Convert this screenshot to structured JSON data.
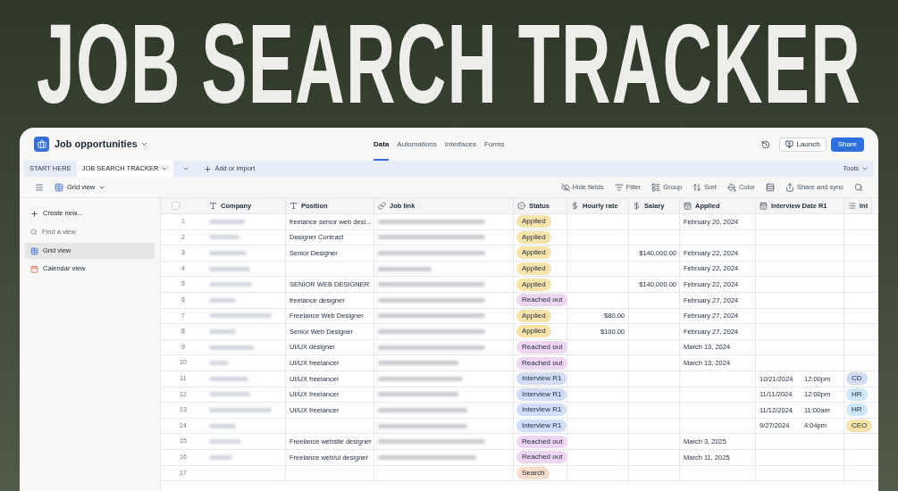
{
  "title": "JOB SEARCH TRACKER",
  "app": {
    "base_name": "Job opportunities",
    "nav_tabs": [
      {
        "label": "Data",
        "selected": true
      },
      {
        "label": "Automations",
        "selected": false
      },
      {
        "label": "Interfaces",
        "selected": false
      },
      {
        "label": "Forms",
        "selected": false
      }
    ],
    "launch": "Launch",
    "share": "Share"
  },
  "table_tabs": [
    {
      "label": "START HERE",
      "selected": false,
      "dropdown": false
    },
    {
      "label": "JOB SEARCH TRACKER",
      "selected": true,
      "dropdown": true
    }
  ],
  "select_all": {
    "checked": false
  },
  "add_import": "Add or import",
  "tools": "Tools",
  "view_name": "Grid view",
  "toolbar": [
    {
      "kind": "hide",
      "label": "Hide fields"
    },
    {
      "kind": "filter",
      "label": "Filter"
    },
    {
      "kind": "group",
      "label": "Group"
    },
    {
      "kind": "sort",
      "label": "Sort"
    },
    {
      "kind": "color",
      "label": "Color"
    },
    {
      "kind": "height"
    },
    {
      "kind": "share",
      "label": "Share and sync"
    },
    {
      "kind": "search"
    }
  ],
  "sidebar": {
    "create": "Create new...",
    "find_placeholder": "Find a view",
    "views": [
      {
        "kind": "grid",
        "label": "Grid view",
        "selected": true
      },
      {
        "kind": "calendar",
        "label": "Calendar view",
        "selected": false
      }
    ]
  },
  "columns": [
    {
      "kind": "text",
      "label": "Company"
    },
    {
      "kind": "text",
      "label": "Position"
    },
    {
      "kind": "link",
      "label": "Job link"
    },
    {
      "kind": "select",
      "label": "Status"
    },
    {
      "kind": "currency",
      "label": "Hourly rate"
    },
    {
      "kind": "currency",
      "label": "Salary"
    },
    {
      "kind": "date",
      "label": "Applied"
    },
    {
      "kind": "date",
      "label": "Interview Date R1"
    },
    {
      "kind": "multi",
      "label": "Int"
    }
  ],
  "rows": [
    {
      "n": "1",
      "company_blurred": true,
      "position": "freelance senior web desi...",
      "link_blurred": true,
      "status": {
        "label": "Applied",
        "color": "#f6e3a9"
      },
      "applied": "February 20, 2024"
    },
    {
      "n": "2",
      "company_blurred": true,
      "position": "Designer Contract",
      "link_blurred": true,
      "status": {
        "label": "Applied",
        "color": "#f6e3a9"
      }
    },
    {
      "n": "3",
      "company_blurred": true,
      "position": "Senior Designer",
      "link_blurred": true,
      "status": {
        "label": "Applied",
        "color": "#f6e3a9"
      },
      "salary": "$140,000.00",
      "applied": "February 22, 2024"
    },
    {
      "n": "4",
      "company_blurred": true,
      "link_blurred": true,
      "status": {
        "label": "Applied",
        "color": "#f6e3a9"
      },
      "applied": "February 22, 2024"
    },
    {
      "n": "5",
      "company_blurred": true,
      "position": "SENIOR WEB DESIGNER",
      "link_blurred": true,
      "status": {
        "label": "Applied",
        "color": "#f6e3a9"
      },
      "salary": "$140,000.00",
      "applied": "February 22, 2024"
    },
    {
      "n": "6",
      "company_blurred": true,
      "position": "freelance designer",
      "link_blurred": true,
      "status": {
        "label": "Reached out",
        "color": "#eed6f3"
      },
      "applied": "February 27, 2024"
    },
    {
      "n": "7",
      "company_blurred": true,
      "position": "Freelance Web Designer",
      "link_blurred": true,
      "status": {
        "label": "Applied",
        "color": "#f6e3a9"
      },
      "hourly": "$80.00",
      "applied": "February 27, 2024"
    },
    {
      "n": "8",
      "company_blurred": true,
      "position": "Senior Web Designer",
      "link_blurred": true,
      "status": {
        "label": "Applied",
        "color": "#f6e3a9"
      },
      "hourly": "$100.00",
      "applied": "February 27, 2024"
    },
    {
      "n": "9",
      "company_blurred": true,
      "position": "UI/UX designer",
      "link_blurred": true,
      "status": {
        "label": "Reached out",
        "color": "#eed6f3"
      },
      "applied": "March 13, 2024"
    },
    {
      "n": "10",
      "company_blurred": true,
      "position": "UI/UX freelancer",
      "link_blurred": true,
      "status": {
        "label": "Reached out",
        "color": "#eed6f3"
      },
      "applied": "March 13, 2024"
    },
    {
      "n": "11",
      "company_blurred": true,
      "position": "UI/UX freelancer",
      "link_blurred": true,
      "status": {
        "label": "Interview R1",
        "color": "#d1ddf6"
      },
      "interview_date": "10/21/2024",
      "interview_time": "12:00pm",
      "interviewer": {
        "label": "CD",
        "color": "#d1ddf6"
      }
    },
    {
      "n": "12",
      "company_blurred": true,
      "position": "UI/UX freelancer",
      "link_blurred": true,
      "status": {
        "label": "Interview R1",
        "color": "#d1ddf6"
      },
      "interview_date": "11/11/2024",
      "interview_time": "12:00pm",
      "interviewer": {
        "label": "HR",
        "color": "#cfe6f6"
      }
    },
    {
      "n": "13",
      "company_blurred": true,
      "position": "UI/UX freelancer",
      "link_blurred": true,
      "status": {
        "label": "Interview R1",
        "color": "#d1ddf6"
      },
      "interview_date": "11/12/2024",
      "interview_time": "11:00am",
      "interviewer": {
        "label": "HR",
        "color": "#cfe6f6"
      }
    },
    {
      "n": "14",
      "company_blurred": true,
      "link_blurred": true,
      "status": {
        "label": "Interview R1",
        "color": "#d1ddf6"
      },
      "interview_date": "9/27/2024",
      "interview_time": "4:04pm",
      "interviewer": {
        "label": "CEO",
        "color": "#f6e3a9"
      }
    },
    {
      "n": "15",
      "company_blurred": true,
      "position": "Freelance website designer",
      "link_blurred": true,
      "status": {
        "label": "Reached out",
        "color": "#eed6f3"
      },
      "applied": "March 3, 2025"
    },
    {
      "n": "16",
      "company_blurred": true,
      "position": "Freelance web/ui designer",
      "link_blurred": true,
      "status": {
        "label": "Reached out",
        "color": "#eed6f3"
      },
      "applied": "March 11, 2025"
    },
    {
      "n": "17",
      "company_blurred": false,
      "link_blurred": false,
      "status": {
        "label": "Search",
        "color": "#f8dbc8"
      }
    }
  ]
}
